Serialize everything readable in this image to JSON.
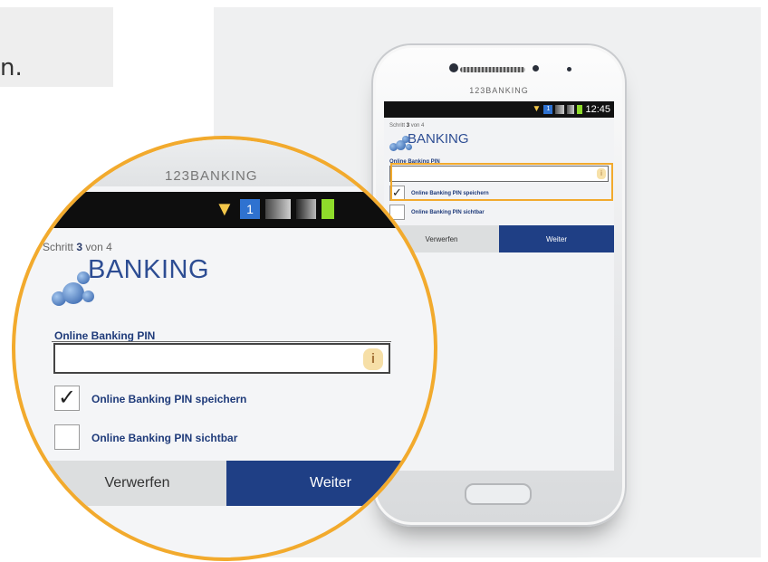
{
  "background": {
    "fragment_text": "n."
  },
  "device": {
    "brand": "123BANKING",
    "time": "12:45",
    "sim_slot": "1"
  },
  "app": {
    "step_prefix": "Schritt",
    "step_current": "3",
    "step_of": "von 4",
    "logo_text": "BANKING",
    "pin_label": "Online Banking PIN",
    "pin_value": "",
    "info_icon": "i",
    "checkboxes": [
      {
        "label": "Online Banking PIN speichern",
        "checked": true,
        "mark": "✓"
      },
      {
        "label": "Online Banking PIN sichtbar",
        "checked": false,
        "mark": ""
      }
    ],
    "buttons": {
      "discard": "Verwerfen",
      "next": "Weiter"
    }
  },
  "colors": {
    "accent_highlight": "#f2aa2d",
    "brand_blue": "#1f3f85",
    "logo_blue": "#2d4d93",
    "battery_green": "#8fdc2b"
  },
  "icons": [
    "wifi-icon",
    "sim-icon",
    "signal-icon",
    "battery-icon",
    "info-icon",
    "checkmark-icon"
  ]
}
